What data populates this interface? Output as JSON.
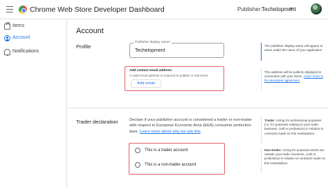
{
  "header": {
    "title": "Chrome Web Store Developer Dashboard",
    "publisher_label": "Publisher:",
    "publisher_name": "Techelopment",
    "icons": [
      "menu-icon",
      "chrome-web-store-logo",
      "chevron-down-icon",
      "avatar"
    ]
  },
  "sidebar": {
    "items": [
      {
        "label": "Items",
        "icon": "package-icon",
        "active": false
      },
      {
        "label": "Account",
        "icon": "account-circle-icon",
        "active": true
      },
      {
        "label": "Notifications",
        "icon": "bell-icon",
        "active": false
      }
    ]
  },
  "main": {
    "title": "Account",
    "profile": {
      "section_label": "Profile",
      "display_name_label": "Publisher display name*",
      "display_name_value": "Techelopment",
      "display_name_help": "The publisher display name will appear to users under the name of your application",
      "contact_email_title": "Add contact email address",
      "contact_email_sub": "A valid email address is required to publish or edit items",
      "add_email_button": "Add email",
      "contact_help": "This address will be publicly displayed in connection with your items.",
      "contact_help_link": "Learn more in the developer agreement"
    },
    "trader": {
      "section_label": "Trader declaration",
      "description": "Declare if your publisher account is considered a trader or non-trader with respect to European Economic Area (EEA) consumer protection laws.",
      "description_link": "Learn more about why we ask this",
      "options": [
        "This is a trader account",
        "This is a non-trader account"
      ],
      "help_trader_term": "Trader:",
      "help_trader": "Acting for professional purposes (i.e. for purposes relating to your trade, business, craft or profession) in relation to contracts made on this marketplace",
      "help_nontrader_term": "Non-trader:",
      "help_nontrader": "Acting for purposes which are outside your trade, business, craft or profession) in relation to contracts made on this marketplace"
    }
  },
  "colors": {
    "accent": "#1a73e8",
    "highlight_border": "#e35b66",
    "divider": "#e0e0e0"
  }
}
